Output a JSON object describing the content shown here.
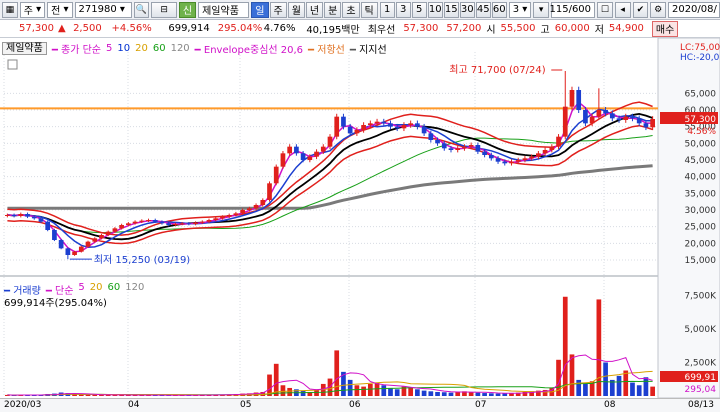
{
  "toolbar": {
    "market_label": "주",
    "all_label": "전",
    "stock_code": "271980",
    "credit_badge": "신",
    "stock_name": "제일약품",
    "periods": [
      "일",
      "주",
      "월",
      "년",
      "분",
      "초",
      "틱"
    ],
    "active_period": "일",
    "intervals": [
      "1",
      "3",
      "5",
      "10",
      "15",
      "30",
      "45",
      "60"
    ],
    "interval_select": "3",
    "count_display": "115/600",
    "date_display": "2020/08/"
  },
  "quote": {
    "price": "57,300",
    "change": "2,500",
    "change_pct": "+4.56%",
    "volume": "699,914",
    "volume_ratio": "295.04%",
    "turnover_ratio": "4.76%",
    "amount": "40,195백만",
    "best_ask_label": "최우선",
    "best_ask": "57,300",
    "best_bid": "57,200",
    "open_label": "시",
    "open": "55,500",
    "high_label": "고",
    "high": "60,000",
    "low_label": "저",
    "low": "54,900",
    "trade_button": "매수"
  },
  "price_legend": {
    "name": "제일약품",
    "ma_label": "종가 단순",
    "ma_periods": [
      "5",
      "10",
      "20",
      "60",
      "120"
    ],
    "ma_colors": [
      "#d010c8",
      "#0030d0",
      "#d8a000",
      "#18a018",
      "#888888"
    ],
    "envelope": "Envelope중심선 20,6",
    "resistance": "저항선",
    "support": "지지선"
  },
  "volume_legend": {
    "label": "거래량",
    "ma_label": "단순",
    "periods": [
      "5",
      "20",
      "60",
      "120"
    ],
    "current": "699,914주(295.04%)"
  },
  "annotations": {
    "high_text": "최고 71,700 (07/24)",
    "low_text": "최저 15,250 (03/19)"
  },
  "price_axis": {
    "lc_label": "LC:75,000",
    "hc_label": "HC:-20,00",
    "ticks": [
      "65,000",
      "60,000",
      "55,000",
      "50,000",
      "45,000",
      "40,000",
      "35,000",
      "30,000",
      "25,000",
      "20,000",
      "15,000"
    ],
    "current_price_tag": "57,300",
    "current_pct_tag": "4.56%"
  },
  "volume_axis": {
    "ticks": [
      "7,500K",
      "5,000K",
      "2,500K"
    ],
    "current_tag": "699,91",
    "avg_tag": "295,04"
  },
  "date_axis": [
    "2020/03",
    "04",
    "05",
    "06",
    "07",
    "08",
    "08/13"
  ],
  "colors": {
    "up": "#e0201c",
    "down": "#1c3fd0",
    "resistance_line": "#ff9a2a",
    "background": "#ffffff"
  },
  "chart_data": {
    "type": "candlestick",
    "x_range": [
      "2020/03",
      "2020/08/13"
    ],
    "y_range_price": [
      12000,
      75000
    ],
    "y_range_volume": [
      0,
      8500000
    ],
    "resistance_level": 60500,
    "high": {
      "value": 71700,
      "date": "07/24"
    },
    "low": {
      "value": 15250,
      "date": "03/19"
    },
    "close_series": [
      28500,
      28200,
      28800,
      28000,
      27500,
      26500,
      24000,
      21000,
      18500,
      16500,
      17500,
      19000,
      20500,
      21500,
      22500,
      23500,
      24500,
      25500,
      26000,
      26500,
      26800,
      27000,
      26500,
      26000,
      25500,
      25800,
      26000,
      25800,
      26200,
      26500,
      27000,
      27500,
      28000,
      28500,
      29000,
      30000,
      30500,
      31500,
      33000,
      38000,
      43000,
      47000,
      49000,
      47000,
      45000,
      46000,
      47500,
      49000,
      52000,
      58000,
      55000,
      53000,
      54000,
      55500,
      56000,
      56500,
      56000,
      55000,
      54500,
      55500,
      56000,
      55000,
      53000,
      51000,
      50000,
      48500,
      48000,
      48500,
      49000,
      49500,
      47500,
      46500,
      45500,
      44500,
      44000,
      44500,
      45000,
      45500,
      46000,
      47000,
      48000,
      49000,
      52000,
      61000,
      66000,
      60000,
      56000,
      58000,
      60000,
      59000,
      57500,
      57000,
      58000,
      57500,
      56000,
      54800,
      57300
    ],
    "volume_series": [
      80000,
      60000,
      90000,
      70000,
      65000,
      75000,
      150000,
      180000,
      260000,
      220000,
      120000,
      100000,
      90000,
      95000,
      80000,
      85000,
      75000,
      80000,
      70000,
      65000,
      60000,
      70000,
      65000,
      60000,
      55000,
      60000,
      65000,
      60000,
      70000,
      75000,
      80000,
      90000,
      100000,
      120000,
      150000,
      180000,
      200000,
      260000,
      300000,
      1600000,
      2400000,
      800000,
      600000,
      500000,
      400000,
      300000,
      500000,
      900000,
      1300000,
      3400000,
      1800000,
      1200000,
      800000,
      700000,
      900000,
      1000000,
      800000,
      600000,
      500000,
      700000,
      650000,
      500000,
      400000,
      350000,
      300000,
      280000,
      250000,
      300000,
      350000,
      280000,
      250000,
      220000,
      200000,
      180000,
      200000,
      220000,
      250000,
      300000,
      350000,
      400000,
      450000,
      600000,
      2700000,
      7400000,
      3100000,
      1200000,
      900000,
      1100000,
      7200000,
      2500000,
      1200000,
      1500000,
      1900000,
      1000000,
      800000,
      1400000,
      699914
    ]
  }
}
